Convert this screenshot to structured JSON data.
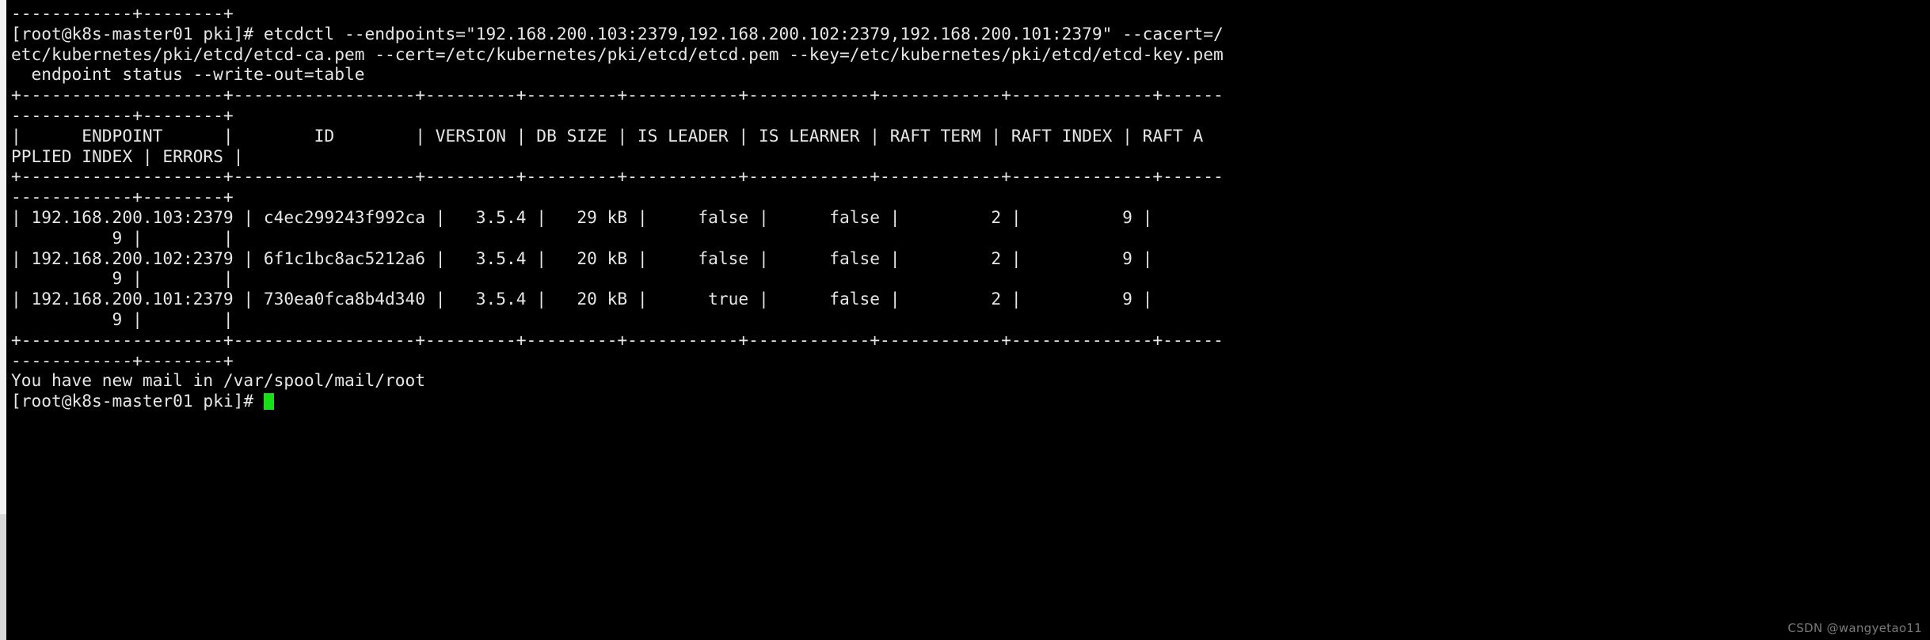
{
  "terminal": {
    "colors": {
      "background": "#000000",
      "foreground": "#e6e6e6",
      "cursor": "#18e018",
      "gutter": "#d9d9d9",
      "watermark": "#7a7a7a"
    },
    "prompt": "[root@k8s-master01 pki]#",
    "hostname": "k8s-master01",
    "user": "root",
    "cwd": "pki",
    "command": "etcdctl --endpoints=\"192.168.200.103:2379,192.168.200.102:2379,192.168.200.101:2379\" --cacert=/etc/kubernetes/pki/etcd/etcd-ca.pem --cert=/etc/kubernetes/pki/etcd/etcd.pem --key=/etc/kubernetes/pki/etcd/etcd-key.pem endpoint status --write-out=table",
    "mail_notice": "You have new mail in /var/spool/mail/root",
    "watermark": "CSDN @wangyetao11",
    "lines": [
      "------------+--------+",
      "[root@k8s-master01 pki]# etcdctl --endpoints=\"192.168.200.103:2379,192.168.200.102:2379,192.168.200.101:2379\" --cacert=/",
      "etc/kubernetes/pki/etcd/etcd-ca.pem --cert=/etc/kubernetes/pki/etcd/etcd.pem --key=/etc/kubernetes/pki/etcd/etcd-key.pem",
      "  endpoint status --write-out=table",
      "+--------------------+------------------+---------+---------+-----------+------------+------------+--------------+------",
      "------------+--------+",
      "|      ENDPOINT      |        ID        | VERSION | DB SIZE | IS LEADER | IS LEARNER | RAFT TERM | RAFT INDEX | RAFT A",
      "PPLIED INDEX | ERRORS |",
      "+--------------------+------------------+---------+---------+-----------+------------+------------+--------------+------",
      "------------+--------+",
      "| 192.168.200.103:2379 | c4ec299243f992ca |   3.5.4 |   29 kB |     false |      false |         2 |          9 |",
      "          9 |        |",
      "| 192.168.200.102:2379 | 6f1c1bc8ac5212a6 |   3.5.4 |   20 kB |     false |      false |         2 |          9 |",
      "          9 |        |",
      "| 192.168.200.101:2379 | 730ea0fca8b4d340 |   3.5.4 |   20 kB |      true |      false |         2 |          9 |",
      "          9 |        |",
      "+--------------------+------------------+---------+---------+-----------+------------+------------+--------------+------",
      "------------+--------+",
      "You have new mail in /var/spool/mail/root",
      "[root@k8s-master01 pki]# "
    ],
    "table": {
      "headers": [
        "ENDPOINT",
        "ID",
        "VERSION",
        "DB SIZE",
        "IS LEADER",
        "IS LEARNER",
        "RAFT TERM",
        "RAFT INDEX",
        "RAFT APPLIED INDEX",
        "ERRORS"
      ],
      "rows": [
        {
          "endpoint": "192.168.200.103:2379",
          "id": "c4ec299243f992ca",
          "version": "3.5.4",
          "db_size": "29 kB",
          "is_leader": "false",
          "is_learner": "false",
          "raft_term": "2",
          "raft_index": "9",
          "raft_applied_index": "9",
          "errors": ""
        },
        {
          "endpoint": "192.168.200.102:2379",
          "id": "6f1c1bc8ac5212a6",
          "version": "3.5.4",
          "db_size": "20 kB",
          "is_leader": "false",
          "is_learner": "false",
          "raft_term": "2",
          "raft_index": "9",
          "raft_applied_index": "9",
          "errors": ""
        },
        {
          "endpoint": "192.168.200.101:2379",
          "id": "730ea0fca8b4d340",
          "version": "3.5.4",
          "db_size": "20 kB",
          "is_leader": "true",
          "is_learner": "false",
          "raft_term": "2",
          "raft_index": "9",
          "raft_applied_index": "9",
          "errors": ""
        }
      ]
    }
  }
}
